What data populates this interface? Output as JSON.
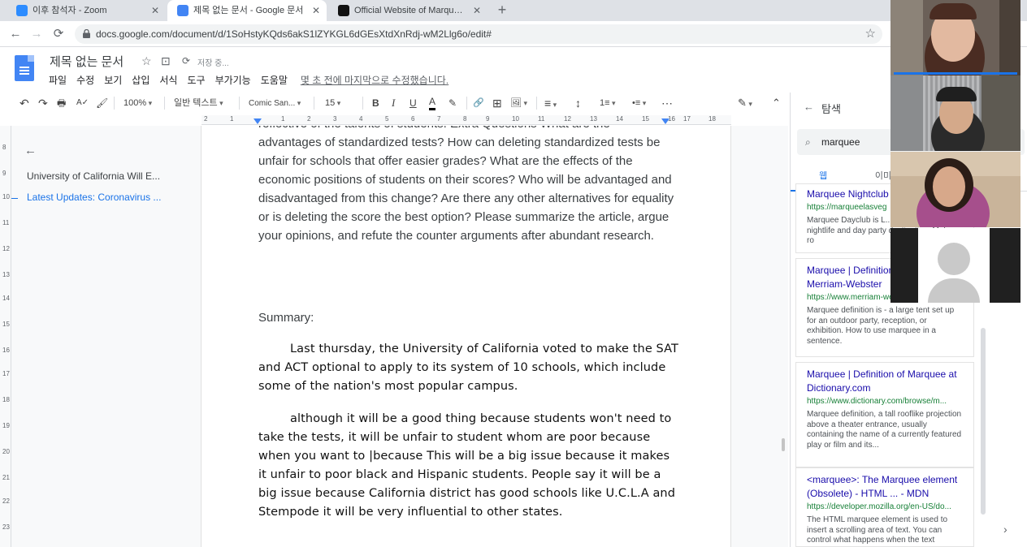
{
  "browser": {
    "tabs": [
      {
        "title": "이후 참석자 - Zoom",
        "favicon_color": "#2d8cff",
        "active": false
      },
      {
        "title": "제목 없는 문서 - Google 문서",
        "favicon_color": "#4285f4",
        "active": true
      },
      {
        "title": "Official Website of Marquee Ni",
        "favicon_color": "#111111",
        "active": false
      }
    ],
    "close_glyph": "✕",
    "new_tab_glyph": "+",
    "url": "docs.google.com/document/d/1SoHstyKQds6akS1lZYKGL6dGEsXtdXnRdj-wM2Llg6o/edit#",
    "nav": {
      "back": "←",
      "forward": "→",
      "reload": "⟳",
      "bookmark": "☆"
    }
  },
  "doc": {
    "title": "제목 없는 문서",
    "saving": "저장 중...",
    "menu": [
      "파일",
      "수정",
      "보기",
      "삽입",
      "서식",
      "도구",
      "부가기능",
      "도움말"
    ],
    "last_edit": "몇 초 전에 마지막으로 수정했습니다.",
    "header_icons": {
      "star": "☆",
      "folder": "⊡",
      "sync": "⟳"
    }
  },
  "toolbar": {
    "undo": "↶",
    "redo": "↷",
    "print": "🖶",
    "spell": "A✓",
    "paint": "🖌",
    "zoom": "100%",
    "style": "일반 텍스트",
    "font": "Comic San...",
    "size": "15",
    "bold": "B",
    "italic": "I",
    "underline": "U",
    "textcolor": "A",
    "highlight": "✎",
    "link": "🔗",
    "comment": "⊞",
    "image": "🖼",
    "align": "≡",
    "spacing": "↕",
    "numlist": "1≡",
    "bullist": "•≡",
    "more": "⋯",
    "edit_mode": "✎",
    "collapse": "⌃"
  },
  "ruler": {
    "labels": [
      "2",
      "1",
      "1",
      "2",
      "3",
      "4",
      "5",
      "6",
      "7",
      "8",
      "9",
      "10",
      "11",
      "12",
      "13",
      "14",
      "15",
      "16",
      "17",
      "18"
    ],
    "vlabels": [
      "8",
      "9",
      "10",
      "11",
      "12",
      "13",
      "14",
      "15",
      "16",
      "17",
      "18",
      "19",
      "20",
      "21",
      "22",
      "23"
    ]
  },
  "outline": {
    "back": "←",
    "items": [
      {
        "label": "University of California Will E...",
        "active": false
      },
      {
        "label": "Latest Updates: Coronavirus ...",
        "active": true
      }
    ]
  },
  "content": {
    "intro_top": "reflective of the talents of students. Extra Questions What are the",
    "intro": "advantages of standardized tests? How can deleting standardized tests be unfair for schools that offer easier grades? What are the effects of the economic positions of students on their scores? Who will be advantaged and disadvantaged from this change? Are there any other alternatives for equality or is deleting the score the best option? Please summarize the article, argue your opinions, and refute the counter arguments after abundant research.",
    "summary_heading": "Summary:",
    "p1": "Last thursday, the University of California voted to make the SAT and ACT optional to apply to its system of 10 schools, which include some of the nation's most popular campus.",
    "p2": "although it will be a good thing because students won't need to take the tests, it will be unfair to student whom are poor because when you want to |because This will be a big issue because it makes it unfair to poor black and Hispanic students. People say it will be a big issue because California district has good schools like U.C.L.A and Stempode it will be very influential to other states."
  },
  "explore": {
    "back": "←",
    "title": "탐색",
    "search_value": "marquee",
    "search_icon": "⌕",
    "tabs": [
      "웹",
      "이미"
    ],
    "results": [
      {
        "title": "Marquee Nightclub",
        "url": "https://marqueelasveg",
        "snippet": "Marquee Dayclub is L... sought after nightlife and day party destination. Make a ro"
      },
      {
        "title": "Marquee | Definition of Marquee by Merriam-Webster",
        "url": "https://www.merriam-webster.com/dic...",
        "snippet": "Marquee definition is - a large tent set up for an outdoor party, reception, or exhibition. How to use marquee in a sentence."
      },
      {
        "title": "Marquee | Definition of Marquee at Dictionary.com",
        "url": "https://www.dictionary.com/browse/m...",
        "snippet": "Marquee definition, a tall rooflike projection above a theater entrance, usually containing the name of a currently featured play or film and its..."
      },
      {
        "title": "<marquee>: The Marquee element (Obsolete) - HTML ... - MDN",
        "url": "https://developer.mozilla.org/en-US/do...",
        "snippet": "The HTML marquee element is used to insert a scrolling area of text. You can control what happens when the text"
      }
    ],
    "next": "›"
  },
  "zoom_tiles": {
    "colors": {
      "tile1_bg": "#6b6058",
      "tile2_bg": "#8a8c8e",
      "tile3_bg": "#c9b49a",
      "tile4_bg": "#202020",
      "avatar": "#c9c9c9"
    }
  }
}
